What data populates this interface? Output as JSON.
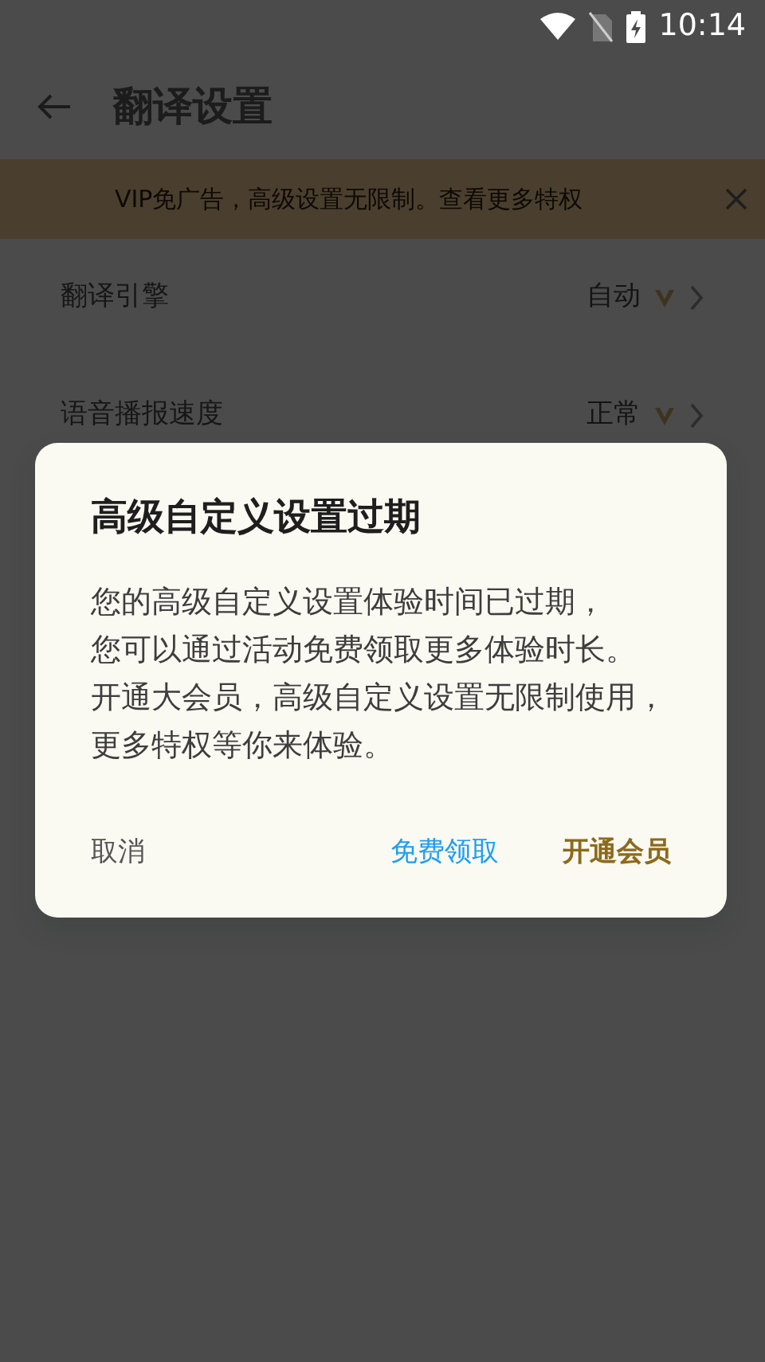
{
  "status_bar": {
    "time": "10:14"
  },
  "app_bar": {
    "title": "翻译设置"
  },
  "banner": {
    "text": "VIP免广告，高级设置无限制。查看更多特权"
  },
  "settings": [
    {
      "label": "翻译引擎",
      "value": "自动",
      "vip": true
    },
    {
      "label": "语音播报速度",
      "value": "正常",
      "vip": true
    }
  ],
  "dialog": {
    "title": "高级自定义设置过期",
    "paragraphs": [
      "您的高级自定义设置体验时间已过期，",
      "您可以通过活动免费领取更多体验时长。",
      "开通大会员，高级自定义设置无限制使用，更多特权等你来体验。"
    ],
    "buttons": [
      {
        "label": "取消",
        "kind": "cancel"
      },
      {
        "label": "免费领取",
        "kind": "link"
      },
      {
        "label": "开通会员",
        "kind": "primary"
      }
    ]
  }
}
